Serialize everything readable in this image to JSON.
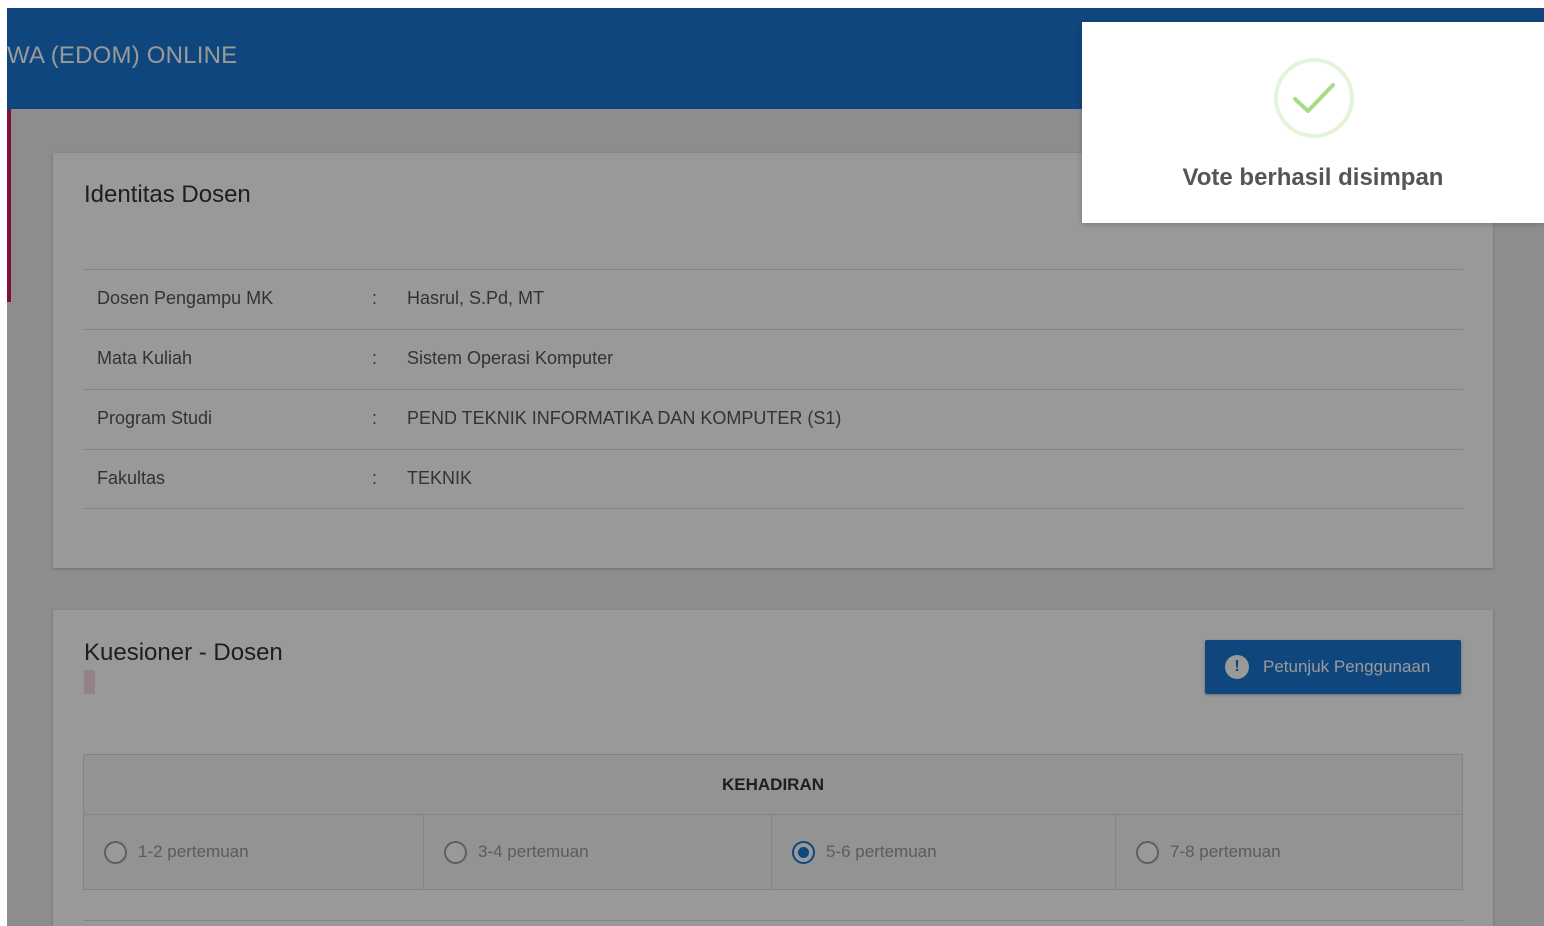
{
  "header": {
    "title": "WA (EDOM) ONLINE"
  },
  "identity_card": {
    "title": "Identitas Dosen",
    "rows": [
      {
        "label": "Dosen Pengampu MK",
        "colon": ":",
        "value": "Hasrul, S.Pd, MT"
      },
      {
        "label": "Mata Kuliah",
        "colon": ":",
        "value": "Sistem Operasi Komputer"
      },
      {
        "label": "Program Studi",
        "colon": ":",
        "value": "PEND TEKNIK INFORMATIKA DAN KOMPUTER  (S1)"
      },
      {
        "label": "Fakultas",
        "colon": ":",
        "value": "TEKNIK"
      }
    ]
  },
  "quiz_card": {
    "title": "Kuesioner - Dosen",
    "help_button_label": "Petunjuk Penggunaan",
    "help_icon": "exclamation-circle-icon",
    "section_header": "KEHADIRAN",
    "options": [
      {
        "label": "1-2 pertemuan",
        "selected": false
      },
      {
        "label": "3-4 pertemuan",
        "selected": false
      },
      {
        "label": "5-6 pertemuan",
        "selected": true
      },
      {
        "label": "7-8 pertemuan",
        "selected": false
      }
    ]
  },
  "toast": {
    "message": "Vote berhasil disimpan",
    "icon": "success-check-icon"
  },
  "colors": {
    "primary": "#1976d2",
    "success": "#a5dc86",
    "accent": "#d81b60"
  }
}
